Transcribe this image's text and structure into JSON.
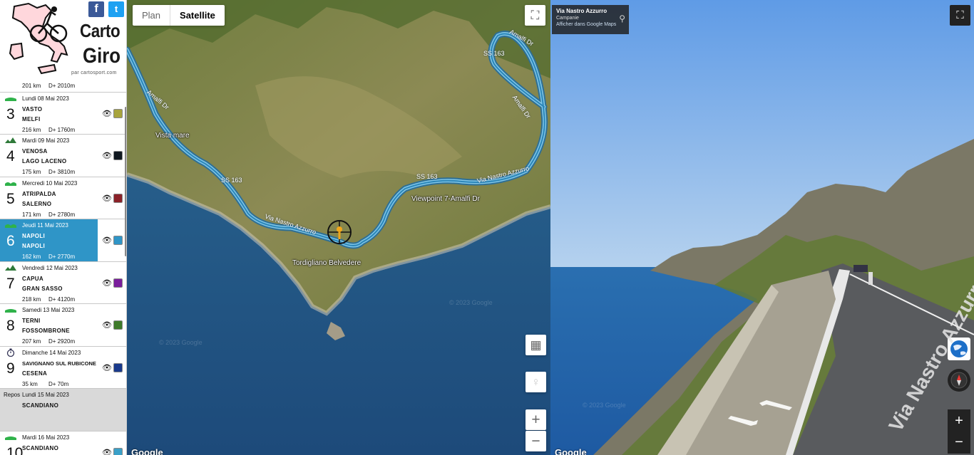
{
  "logo": {
    "line1": "Carto",
    "line2": "Giro",
    "tagline": "par cartosport.com"
  },
  "social": {
    "facebook": "f",
    "twitter": "t"
  },
  "stages": [
    {
      "type": "partial",
      "km": "201 km",
      "dplus": "D+ 2010m"
    },
    {
      "type": "normal",
      "profile": "flat",
      "date": "Lundi 08 Mai 2023",
      "num": "3",
      "city1": "VASTO",
      "city2": "MELFI",
      "km": "216 km",
      "dplus": "D+ 1760m",
      "color": "#a8a43c"
    },
    {
      "type": "normal",
      "profile": "mountain",
      "date": "Mardi 09 Mai 2023",
      "num": "4",
      "city1": "VENOSA",
      "city2": "LAGO LACENO",
      "km": "175 km",
      "dplus": "D+ 3810m",
      "color": "#101820"
    },
    {
      "type": "normal",
      "profile": "hilly",
      "date": "Mercredi 10 Mai 2023",
      "num": "5",
      "city1": "ATRIPALDA",
      "city2": "SALERNO",
      "km": "171 km",
      "dplus": "D+ 2780m",
      "color": "#8b2128"
    },
    {
      "type": "selected",
      "profile": "hilly",
      "date": "Jeudi 11 Mai 2023",
      "num": "6",
      "city1": "NAPOLI",
      "city2": "NAPOLI",
      "km": "162 km",
      "dplus": "D+ 2770m",
      "color": "#2f95c7"
    },
    {
      "type": "normal",
      "profile": "mountain",
      "date": "Vendredi 12 Mai 2023",
      "num": "7",
      "city1": "CAPUA",
      "city2": "GRAN SASSO",
      "km": "218 km",
      "dplus": "D+ 4120m",
      "color": "#7a1e9c"
    },
    {
      "type": "normal",
      "profile": "flat",
      "date": "Samedi 13 Mai 2023",
      "num": "8",
      "city1": "TERNI",
      "city2": "FOSSOMBRONE",
      "km": "207 km",
      "dplus": "D+ 2920m",
      "color": "#3e7a2a"
    },
    {
      "type": "normal",
      "profile": "chrono",
      "date": "Dimanche 14 Mai 2023",
      "num": "9",
      "city1": "SAVIGNANO SUL RUBICONE",
      "city2": "CESENA",
      "km": "35 km",
      "dplus": "D+ 70m",
      "color": "#1a3a8c"
    },
    {
      "type": "rest",
      "repos": "Repos",
      "date": "Lundi 15 Mai 2023",
      "city1": "SCANDIANO"
    },
    {
      "type": "normal",
      "profile": "flat",
      "date": "Mardi 16 Mai 2023",
      "num": "10",
      "city1": "SCANDIANO",
      "city2": "",
      "km": "",
      "dplus": "",
      "color": "#3aa0c8"
    }
  ],
  "map": {
    "type_plan": "Plan",
    "type_satellite": "Satellite",
    "labels": {
      "vista_mare": "Vista mare",
      "viewpoint": "Viewpoint 7-Amalfi Dr",
      "tordigliano": "Tordigliano Belvedere",
      "road_nastro": "Via Nastro Azzurro",
      "road_amalfi1": "Amalfi Dr",
      "road_amalfi2": "Amalfi Dr",
      "road_amalfi3": "Amalfi Dr",
      "road_nastro2": "Via Nastro Azzurro",
      "ss1": "SS 163",
      "ss2": "SS 163",
      "ss3": "SS 163",
      "watermark": "© 2023 Google",
      "google": "Google"
    },
    "icons": {
      "fullscreen": "⛶",
      "layers": "▦",
      "pegman": "♀",
      "zoom_in": "+",
      "zoom_out": "−"
    }
  },
  "streetview": {
    "title": "Via Nastro Azzurro",
    "region": "Campanie",
    "link": "Afficher dans Google Maps",
    "road_text": "Via Nastro Azzurro",
    "watermark": "© 2023 Google",
    "google": "Google",
    "icons": {
      "fullscreen": "⛶",
      "zoom_in": "+",
      "zoom_out": "−",
      "pin": "⚲"
    }
  }
}
